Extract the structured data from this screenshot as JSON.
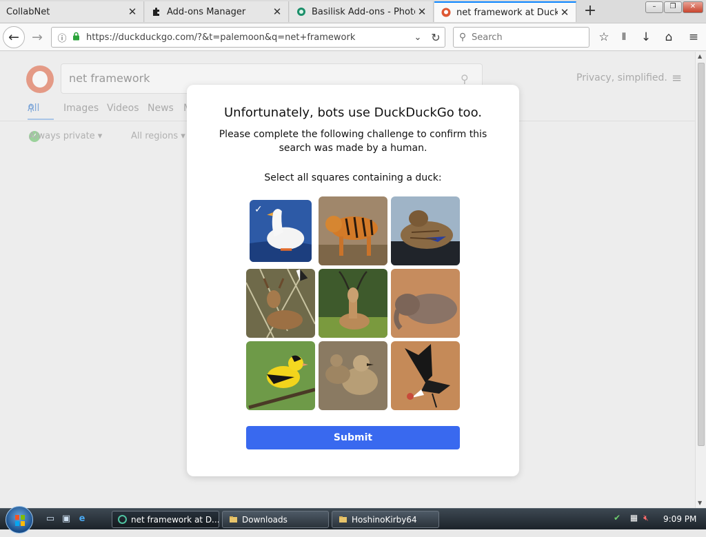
{
  "browser": {
    "tabs": [
      {
        "label": "CollabNet",
        "icon": "none"
      },
      {
        "label": "Add-ons Manager",
        "icon": "puzzle-icon"
      },
      {
        "label": "Basilisk Add-ons - Photonic",
        "icon": "addon-site-icon"
      },
      {
        "label": "net framework at DuckDuck",
        "icon": "duckduckgo-icon"
      }
    ],
    "close_glyph": "✕",
    "new_tab_glyph": "+",
    "url": "https://duckduckgo.com/?&t=palemoon&q=net+framework",
    "search_placeholder": "Search"
  },
  "ddg": {
    "search_value": "net framework",
    "tabs": [
      "All",
      "Images",
      "Videos",
      "News",
      "M"
    ],
    "filters": [
      "Always private ▾",
      "All regions ▾"
    ],
    "tagline": "Privacy, simplified."
  },
  "challenge": {
    "title": "Unfortunately, bots use DuckDuckGo too.",
    "subtitle": "Please complete the following challenge to confirm this search was made by a human.",
    "instruction": "Select all squares containing a duck:",
    "tiles": [
      {
        "subject": "white duck",
        "selected": true
      },
      {
        "subject": "tiger",
        "selected": false
      },
      {
        "subject": "mallard duck",
        "selected": false
      },
      {
        "subject": "deer",
        "selected": false
      },
      {
        "subject": "antelope",
        "selected": false
      },
      {
        "subject": "elephant",
        "selected": false
      },
      {
        "subject": "goldfinch",
        "selected": false
      },
      {
        "subject": "ducklings",
        "selected": false
      },
      {
        "subject": "condor",
        "selected": false
      }
    ],
    "submit_label": "Submit"
  },
  "taskbar": {
    "tasks": [
      {
        "label": "net framework at D...",
        "icon": "palemoon-icon",
        "active": true
      },
      {
        "label": "Downloads",
        "icon": "folder-icon",
        "active": false
      },
      {
        "label": "HoshinoKirby64",
        "icon": "folder-icon",
        "active": false
      }
    ],
    "clock": "9:09 PM"
  },
  "colors": {
    "accent": "#3969ef",
    "tab_highlight": "#0a84ff",
    "ddg_orange": "#de5833"
  }
}
